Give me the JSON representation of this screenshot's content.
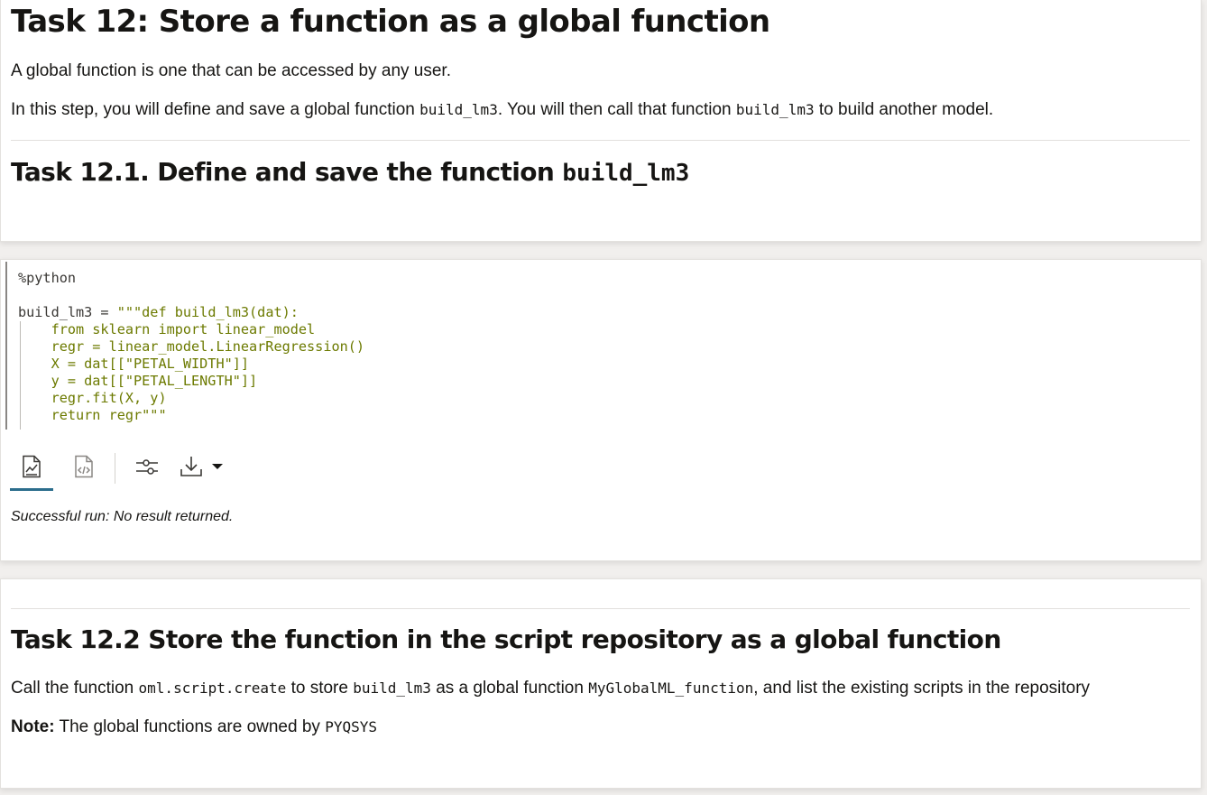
{
  "section1": {
    "title": "Task 12: Store a function as a global function",
    "intro": "A global function is one that can be accessed by any user.",
    "step_pre": "In this step, you will define and save a global function ",
    "step_code1": "build_lm3",
    "step_mid": ". You will then call that function ",
    "step_code2": "build_lm3",
    "step_post": " to build another model.",
    "sub_title_text": "Task 12.1. Define and save the function ",
    "sub_title_code": "build_lm3"
  },
  "code_cell": {
    "interpreter": "%python",
    "line_assign_prefix": "build_lm3 = ",
    "lines": [
      "\"\"\"def build_lm3(dat):",
      "    from sklearn import linear_model",
      "    regr = linear_model.LinearRegression()",
      "    X = dat[[\"PETAL_WIDTH\"]]",
      "    y = dat[[\"PETAL_LENGTH\"]]",
      "    regr.fit(X, y)",
      "    return regr\"\"\""
    ],
    "toolbar": {
      "icons": [
        "chart-result-icon",
        "code-view-icon",
        "settings-sliders-icon",
        "download-icon",
        "caret-down-icon"
      ]
    },
    "status": "Successful run: No result returned."
  },
  "section3": {
    "title": "Task 12.2 Store the function in the script repository as a global function",
    "call_pre": "Call the function ",
    "call_code1": "oml.script.create",
    "call_mid1": " to store ",
    "call_code2": "build_lm3",
    "call_mid2": " as a global function ",
    "call_code3": "MyGlobalML_function",
    "call_post": ", and list the existing scripts in the repository",
    "note_label": "Note:",
    "note_text": " The global functions are owned by ",
    "note_code": "PYQSYS"
  },
  "colors": {
    "accent_tab": "#2b6d8c",
    "code_string": "#6c7a00",
    "background": "#f1efed"
  }
}
